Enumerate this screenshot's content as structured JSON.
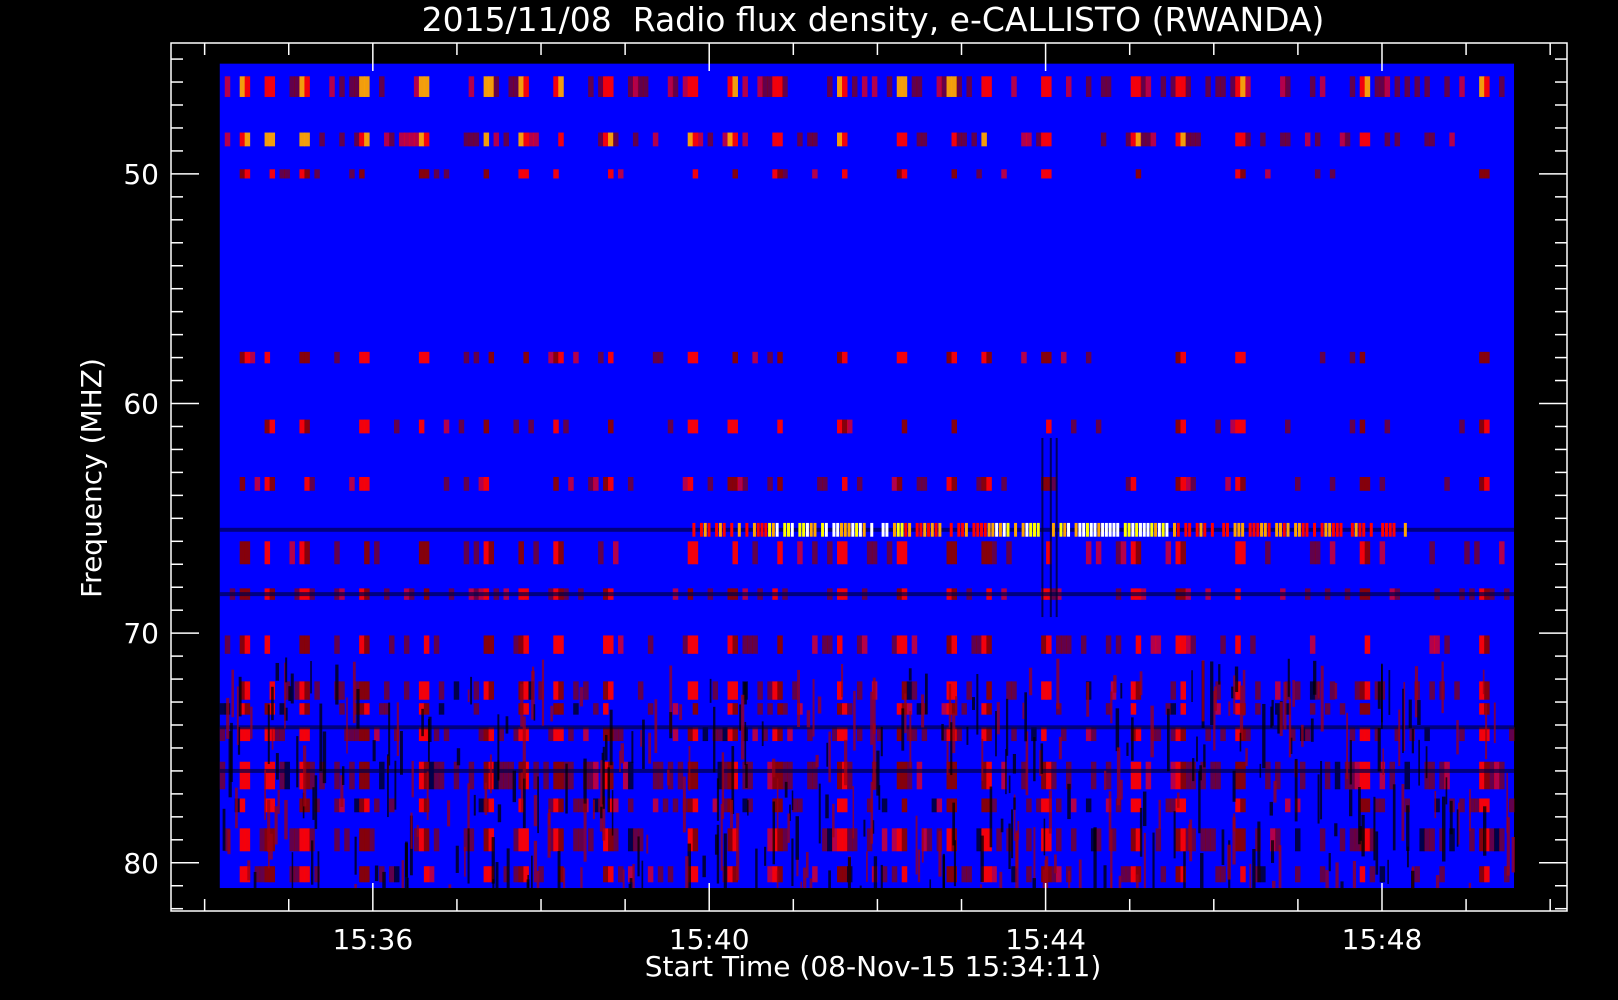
{
  "chart_data": {
    "type": "heatmap",
    "title": "2015/11/08  Radio flux density, e-CALLISTO (RWANDA)",
    "xlabel": "Start Time (08-Nov-15 15:34:11)",
    "ylabel": "Frequency (MHZ)",
    "x_ticks": [
      "15:36",
      "15:40",
      "15:44",
      "15:48"
    ],
    "y_ticks": [
      50,
      60,
      70,
      80
    ],
    "xlim_minutes": [
      33.6,
      50.2
    ],
    "data_x_range_minutes": [
      34.18,
      49.57
    ],
    "ylim_mhz": [
      44.3,
      82.1
    ],
    "data_y_range_mhz": [
      45.2,
      81.1
    ],
    "y_inverted": true,
    "colormap": [
      "#000000",
      "#0000ff",
      "#8b0000",
      "#ff0000",
      "#ffa500",
      "#ffff00",
      "#ffffff"
    ],
    "background_value": "#0000ff",
    "features": [
      {
        "type": "rfi_band",
        "freq_mhz": 65.5,
        "t_start": 39.8,
        "t_end": 48.3,
        "intensity": "high"
      },
      {
        "type": "rfi_band",
        "freq_mhz": 46.2,
        "t_start": 34.2,
        "t_end": 49.6,
        "intensity": "medium"
      },
      {
        "type": "rfi_band",
        "freq_mhz": 48.5,
        "t_start": 34.2,
        "t_end": 49.6,
        "intensity": "low"
      },
      {
        "type": "rfi_band",
        "freq_mhz": 68.3,
        "t_start": 34.2,
        "t_end": 49.6,
        "intensity": "low"
      },
      {
        "type": "noise_region",
        "freq_min": 70,
        "freq_max": 81.1
      }
    ]
  }
}
